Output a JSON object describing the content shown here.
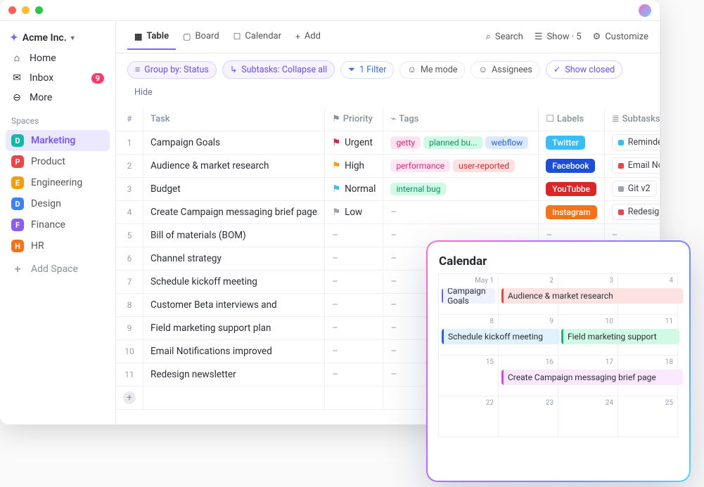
{
  "workspace": {
    "name": "Acme Inc."
  },
  "sidebar": {
    "nav": [
      {
        "icon": "⌂",
        "label": "Home",
        "badge": null
      },
      {
        "icon": "✉",
        "label": "Inbox",
        "badge": "9"
      },
      {
        "icon": "⊖",
        "label": "More",
        "badge": null
      }
    ],
    "spaces_title": "Spaces",
    "spaces": [
      {
        "letter": "D",
        "label": "Marketing",
        "color": "#14b8a6",
        "active": true
      },
      {
        "letter": "P",
        "label": "Product",
        "color": "#ef4444",
        "active": false
      },
      {
        "letter": "E",
        "label": "Engineering",
        "color": "#f59e0b",
        "active": false
      },
      {
        "letter": "D",
        "label": "Design",
        "color": "#3b82f6",
        "active": false
      },
      {
        "letter": "F",
        "label": "Finance",
        "color": "#8b5cf6",
        "active": false
      },
      {
        "letter": "H",
        "label": "HR",
        "color": "#f97316",
        "active": false
      }
    ],
    "add_space": "Add Space"
  },
  "views": {
    "tabs": [
      {
        "icon": "▦",
        "label": "Table",
        "active": true
      },
      {
        "icon": "▢",
        "label": "Board",
        "active": false
      },
      {
        "icon": "☐",
        "label": "Calendar",
        "active": false
      },
      {
        "icon": "+",
        "label": "Add",
        "active": false
      }
    ],
    "right": {
      "search": "Search",
      "show": "Show · 5",
      "customize": "Customize"
    }
  },
  "filters": {
    "group_by": "Group by: Status",
    "subtasks": "Subtasks: Collapse all",
    "filter": "1 Filter",
    "me_mode": "Me mode",
    "assignees": "Assignees",
    "show_closed": "Show closed",
    "hide": "Hide"
  },
  "columns": {
    "index": "#",
    "task": "Task",
    "priority": "Priority",
    "tags": "Tags",
    "labels": "Labels",
    "subtasks": "Subtasks"
  },
  "priorities": {
    "urgent": {
      "label": "Urgent",
      "color": "#e11d48"
    },
    "high": {
      "label": "High",
      "color": "#f59e0b"
    },
    "normal": {
      "label": "Normal",
      "color": "#38bdf8"
    },
    "low": {
      "label": "Low",
      "color": "#9ca3af"
    }
  },
  "rows": [
    {
      "n": "1",
      "task": "Campaign Goals",
      "prio": "urgent",
      "tags": [
        {
          "t": "getty",
          "bg": "#ffe4ef",
          "fg": "#db2777"
        },
        {
          "t": "planned bu...",
          "bg": "#d1fae5",
          "fg": "#059669"
        },
        {
          "t": "webflow",
          "bg": "#dbeafe",
          "fg": "#2563eb"
        }
      ],
      "label": {
        "t": "Twitter",
        "bg": "#38bdf8"
      },
      "sub": {
        "t": "Reminders for",
        "c": "#38bdf8"
      }
    },
    {
      "n": "2",
      "task": "Audience & market research",
      "prio": "high",
      "tags": [
        {
          "t": "performance",
          "bg": "#fce7f3",
          "fg": "#db2777"
        },
        {
          "t": "user-reported",
          "bg": "#fee2e2",
          "fg": "#dc2626"
        }
      ],
      "label": {
        "t": "Facebook",
        "bg": "#1d4ed8"
      },
      "sub": {
        "t": "Email Notificat",
        "c": "#ef4444"
      }
    },
    {
      "n": "3",
      "task": "Budget",
      "prio": "normal",
      "tags": [
        {
          "t": "internal bug",
          "bg": "#d1fae5",
          "fg": "#059669"
        }
      ],
      "label": {
        "t": "YouTubbe",
        "bg": "#dc2626"
      },
      "sub": {
        "t": "Git v2",
        "c": "#9ca3af",
        "plus": true
      }
    },
    {
      "n": "4",
      "task": "Create Campaign messaging brief page",
      "prio": "low",
      "tags": [],
      "label": {
        "t": "Instagram",
        "bg": "#f97316"
      },
      "sub": {
        "t": "Redesign Chro",
        "c": "#ef4444"
      }
    },
    {
      "n": "5",
      "task": "Bill of materials (BOM)",
      "prio": null,
      "tags": [],
      "label": null,
      "sub": null
    },
    {
      "n": "6",
      "task": "Channel strategy",
      "prio": null,
      "tags": [],
      "label": null,
      "sub": null
    },
    {
      "n": "7",
      "task": "Schedule kickoff meeting",
      "prio": null,
      "tags": [],
      "label": null,
      "sub": null
    },
    {
      "n": "8",
      "task": "Customer Beta interviews and",
      "prio": null,
      "tags": [],
      "label": null,
      "sub": null
    },
    {
      "n": "9",
      "task": "Field marketing support plan",
      "prio": null,
      "tags": [],
      "label": null,
      "sub": null
    },
    {
      "n": "10",
      "task": "Email Notifications improved",
      "prio": null,
      "tags": [],
      "label": null,
      "sub": null
    },
    {
      "n": "11",
      "task": "Redesign newsletter",
      "prio": null,
      "tags": [],
      "label": null,
      "sub": null
    }
  ],
  "calendar": {
    "title": "Calendar",
    "month_label": "May 1",
    "dates": [
      "May 1",
      "2",
      "3",
      "4",
      "8",
      "9",
      "10",
      "11",
      "15",
      "16",
      "17",
      "18",
      "22",
      "23",
      "24",
      "25"
    ],
    "events": [
      {
        "cell": 0,
        "span": 1,
        "text": "Campaign Goals",
        "bg": "#eef2ff",
        "bar": "#6366f1"
      },
      {
        "cell": 1,
        "span": 3,
        "text": "Audience & market research",
        "bg": "#fee2e2",
        "bar": "#ef4444"
      },
      {
        "cell": 4,
        "span": 2,
        "text": "Schedule kickoff meeting",
        "bg": "#e0f2fe",
        "bar": "#2563eb"
      },
      {
        "cell": 6,
        "span": 2,
        "text": "Field marketing support",
        "bg": "#d1fae5",
        "bar": "#10b981"
      },
      {
        "cell": 9,
        "span": 3,
        "text": "Create Campaign messaging brief page",
        "bg": "#fae8ff",
        "bar": "#d946ef"
      }
    ]
  }
}
